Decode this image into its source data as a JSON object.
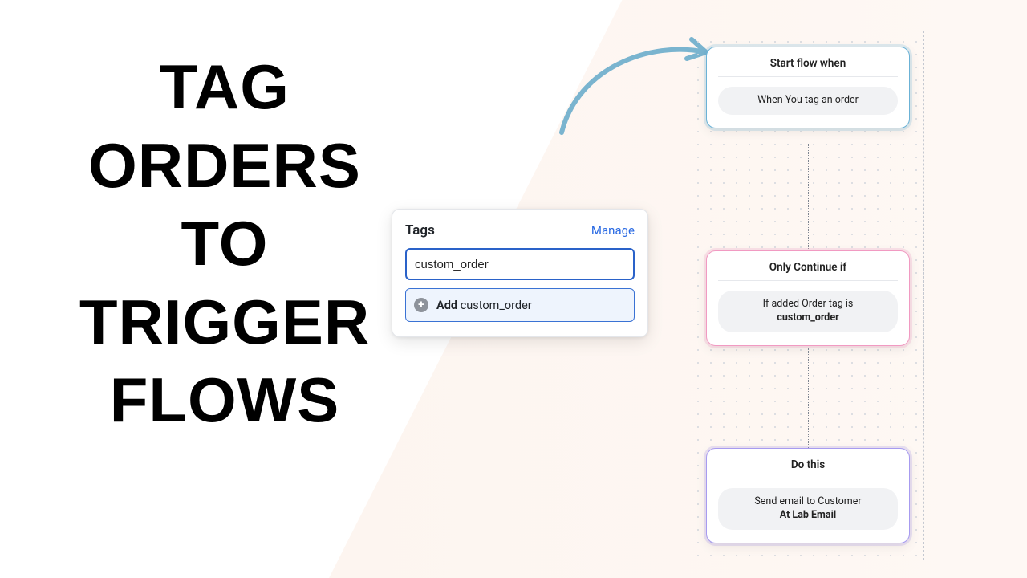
{
  "headline": "TAG ORDERS TO TRIGGER FLOWS",
  "tags_panel": {
    "title": "Tags",
    "manage_label": "Manage",
    "input_value": "custom_order",
    "suggestion_prefix": "Add",
    "suggestion_value": "custom_order"
  },
  "flow": {
    "trigger": {
      "title": "Start flow when",
      "chip": "When You tag an order"
    },
    "condition": {
      "title": "Only Continue if",
      "chip_line1": "If added Order tag is",
      "chip_line2": "custom_order"
    },
    "action": {
      "title": "Do this",
      "chip_line1": "Send email to Customer",
      "chip_line2": "At Lab Email"
    }
  }
}
